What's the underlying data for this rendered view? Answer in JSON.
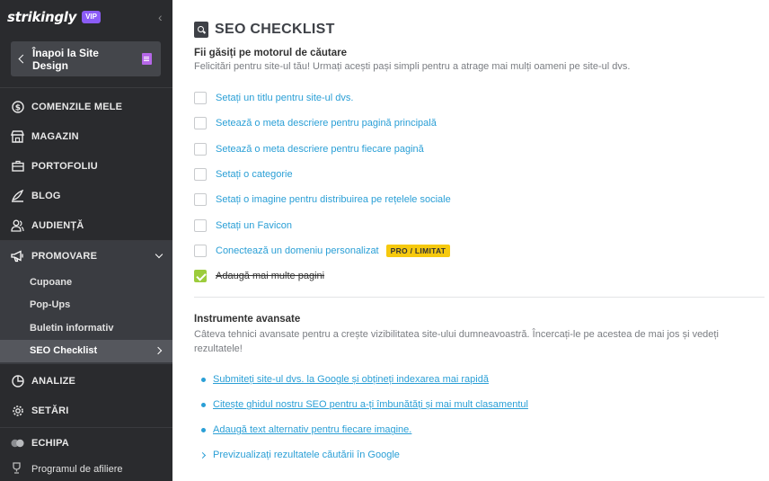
{
  "sidebar": {
    "logo": "strikingly",
    "vip": "VIP",
    "back_label": "Înapoi la Site Design",
    "items": [
      {
        "label": "COMENZILE MELE",
        "icon": "dollar-circle-icon"
      },
      {
        "label": "MAGAZIN",
        "icon": "store-icon"
      },
      {
        "label": "PORTOFOLIU",
        "icon": "briefcase-icon"
      },
      {
        "label": "BLOG",
        "icon": "pen-icon"
      },
      {
        "label": "AUDIENȚĂ",
        "icon": "people-icon"
      },
      {
        "label": "PROMOVARE",
        "icon": "megaphone-icon"
      },
      {
        "label": "ANALIZE",
        "icon": "pie-chart-icon"
      },
      {
        "label": "SETĂRI",
        "icon": "gear-icon"
      },
      {
        "label": "ECHIPA",
        "icon": "team-icon"
      }
    ],
    "sub_items": [
      "Cupoane",
      "Pop-Ups",
      "Buletin informativ",
      "SEO Checklist"
    ],
    "footer": "Programul de afiliere"
  },
  "main": {
    "title": "SEO CHECKLIST",
    "section_heading": "Fii găsiți pe motorul de căutare",
    "section_desc": "Felicitări pentru site-ul tău! Urmați acești pași simpli pentru a atrage mai mulți oameni pe site-ul dvs.",
    "checklist": [
      {
        "label": "Setați un titlu pentru site-ul dvs.",
        "checked": false
      },
      {
        "label": "Setează o meta descriere pentru pagină principală",
        "checked": false
      },
      {
        "label": "Setează o meta descriere pentru fiecare pagină",
        "checked": false
      },
      {
        "label": "Setați o categorie",
        "checked": false
      },
      {
        "label": "Setați o imagine pentru distribuirea pe rețelele sociale",
        "checked": false
      },
      {
        "label": "Setați un Favicon",
        "checked": false
      },
      {
        "label": "Conectează un domeniu personalizat",
        "checked": false,
        "badge": "PRO / LIMITAT"
      },
      {
        "label": "Adaugă mai multe pagini",
        "checked": true
      }
    ],
    "advanced_heading": "Instrumente avansate",
    "advanced_desc": "Câteva tehnici avansate pentru a crește vizibilitatea site-ului dumneavoastră. Încercați-le pe acestea de mai jos și vedeți rezultatele!",
    "tools": [
      "Submiteți site-ul dvs. la Google și obțineți indexarea mai rapidă",
      "Citește ghidul nostru SEO pentru a-ți îmbunătăți și mai mult clasamentul",
      "Adaugă text alternativ pentru fiecare imagine."
    ],
    "preview_label": "Previzualizați rezultatele căutării în Google"
  },
  "colors": {
    "sidebar_bg": "#2a2b2e",
    "accent": "#2a9fd6",
    "check_green": "#9ccc3c",
    "badge": "#f6c90e",
    "vip": "#8b5cf6"
  }
}
